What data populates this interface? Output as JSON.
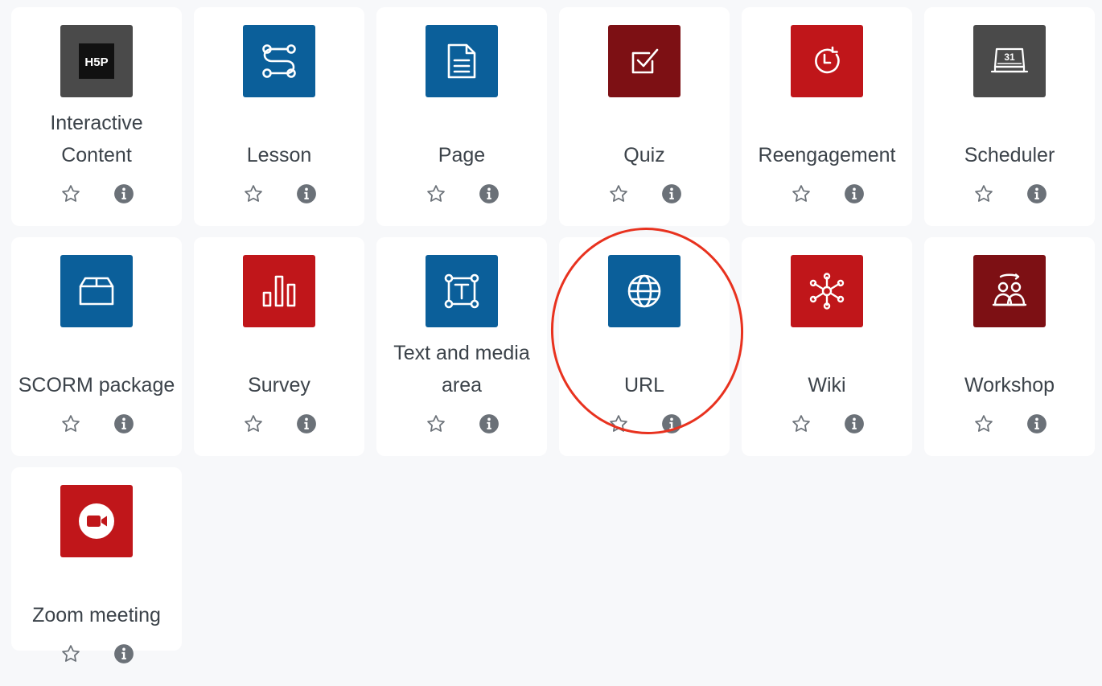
{
  "colors": {
    "background": "#f7f8fa",
    "card": "#ffffff",
    "text": "#3c434a",
    "icon_action": "#6b7178",
    "blue": "#0b5f9a",
    "red": "#c0161a",
    "darkred": "#7d1014",
    "gray": "#4a4a4a",
    "annotation": "#e8321f"
  },
  "activities": [
    {
      "label": "Interactive Content",
      "icon": "h5p-icon",
      "bg": "#4a4a4a"
    },
    {
      "label": "Lesson",
      "icon": "lesson-path-icon",
      "bg": "#0b5f9a"
    },
    {
      "label": "Page",
      "icon": "page-document-icon",
      "bg": "#0b5f9a"
    },
    {
      "label": "Quiz",
      "icon": "quiz-checkbox-icon",
      "bg": "#7d1014"
    },
    {
      "label": "Reengagement",
      "icon": "reengagement-clock-icon",
      "bg": "#c0161a"
    },
    {
      "label": "Scheduler",
      "icon": "scheduler-calendar-icon",
      "bg": "#4a4a4a"
    },
    {
      "label": "SCORM package",
      "icon": "scorm-box-icon",
      "bg": "#0b5f9a"
    },
    {
      "label": "Survey",
      "icon": "survey-bars-icon",
      "bg": "#c0161a"
    },
    {
      "label": "Text and media area",
      "icon": "text-media-icon",
      "bg": "#0b5f9a"
    },
    {
      "label": "URL",
      "icon": "url-globe-icon",
      "bg": "#0b5f9a"
    },
    {
      "label": "Wiki",
      "icon": "wiki-network-icon",
      "bg": "#c0161a"
    },
    {
      "label": "Workshop",
      "icon": "workshop-people-icon",
      "bg": "#7d1014"
    },
    {
      "label": "Zoom meeting",
      "icon": "zoom-camera-icon",
      "bg": "#c0161a"
    }
  ],
  "calendar_day": "31",
  "h5p_text": "H5P",
  "action_icons": {
    "star": "star-outline-icon",
    "info": "info-circle-icon"
  },
  "annotation": {
    "target": "URL",
    "shape": "ellipse"
  }
}
